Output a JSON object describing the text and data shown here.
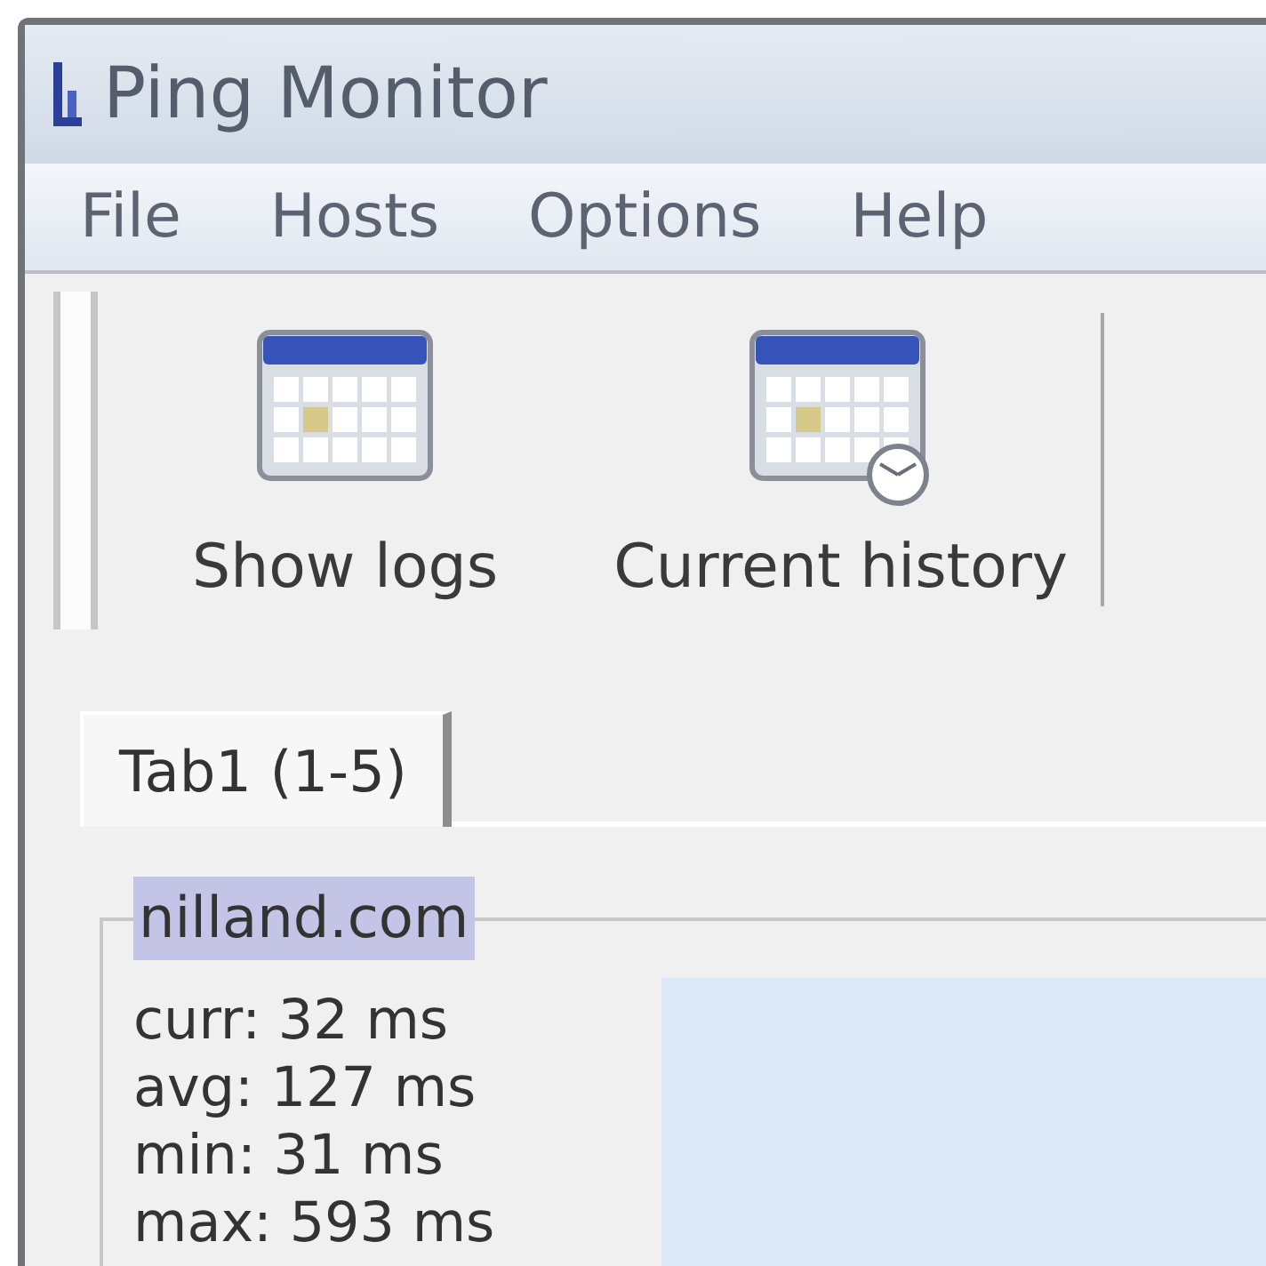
{
  "window": {
    "title": "Ping Monitor"
  },
  "menu": [
    "File",
    "Hosts",
    "Options",
    "Help"
  ],
  "toolbar": [
    {
      "label": "Show logs",
      "kind": "calendar"
    },
    {
      "label": "Current history",
      "kind": "calendar-clock"
    }
  ],
  "tabs": [
    {
      "label": "Tab1 (1-5)",
      "selected": true
    }
  ],
  "host": {
    "name": "nilland.com",
    "highlighted": true,
    "stats": [
      "curr: 32 ms",
      "avg: 127 ms",
      "min: 31 ms",
      "max: 593 ms"
    ]
  }
}
